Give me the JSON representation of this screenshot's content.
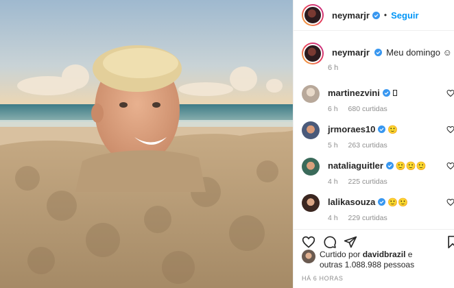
{
  "post": {
    "username": "neymarjr",
    "follow_label": "Seguir",
    "separator": "•",
    "caption": "Meu domingo",
    "caption_emoji": "☺",
    "caption_time": "6 h"
  },
  "comments": [
    {
      "username": "martinezvini",
      "text": "",
      "time": "6 h",
      "likes": "680 curtidas"
    },
    {
      "username": "jrmoraes10",
      "text": "🙂",
      "time": "5 h",
      "likes": "263 curtidas"
    },
    {
      "username": "nataliaguitler",
      "text": "🙂🙂🙂",
      "time": "4 h",
      "likes": "225 curtidas"
    },
    {
      "username": "lalikasouza",
      "text": "🙂🙂",
      "time": "4 h",
      "likes": "229 curtidas"
    }
  ],
  "liked_by": {
    "prefix": "Curtido por",
    "user": "davidbrazil",
    "connector": "e",
    "others": "outras 1.088.988 pessoas"
  },
  "post_time": "HÁ 6 HORAS",
  "icons": [
    "verified-badge-icon",
    "heart-icon",
    "comment-icon",
    "share-icon",
    "bookmark-icon"
  ],
  "colors": {
    "accent": "#0095f6",
    "verified": "#3897f0",
    "muted": "#8e8e8e"
  }
}
